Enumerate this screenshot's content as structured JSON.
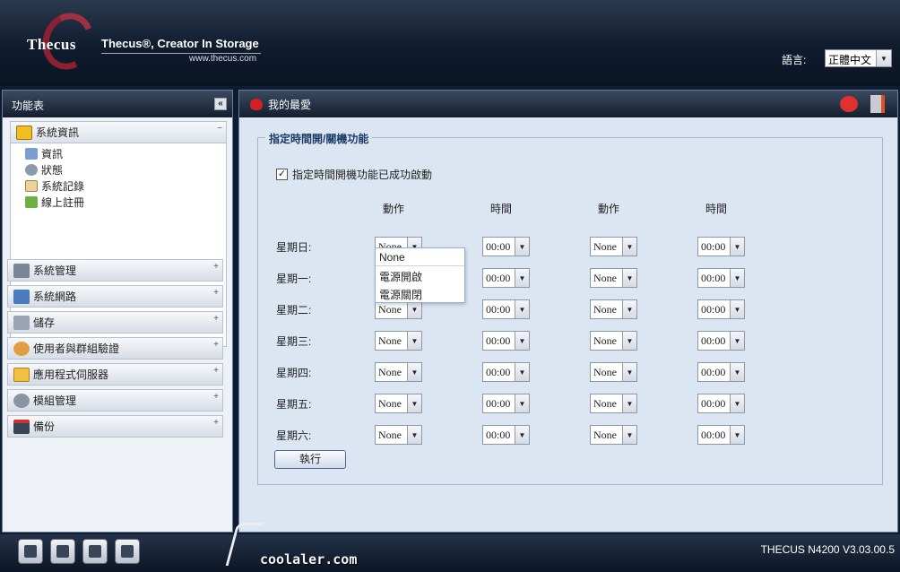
{
  "header": {
    "logo": "Thecus",
    "tagline": "Thecus®, Creator In Storage",
    "url": "www.thecus.com",
    "language_label": "語言:",
    "language_value": "正體中文"
  },
  "sidebar": {
    "title": "功能表",
    "collapse_label": "«",
    "open_section": {
      "label": "系統資訊",
      "toggle": "−",
      "items": [
        {
          "label": "資訊",
          "icon": "info-icon"
        },
        {
          "label": "狀態",
          "icon": "status-icon"
        },
        {
          "label": "系統記錄",
          "icon": "log-icon"
        },
        {
          "label": "線上註冊",
          "icon": "register-icon"
        }
      ]
    },
    "sections": [
      {
        "label": "系統管理",
        "icon": "tools-icon",
        "toggle": "+"
      },
      {
        "label": "系統網路",
        "icon": "network-icon",
        "toggle": "+"
      },
      {
        "label": "儲存",
        "icon": "storage-icon",
        "toggle": "+"
      },
      {
        "label": "使用者與群組驗證",
        "icon": "users-icon",
        "toggle": "+"
      },
      {
        "label": "應用程式伺服器",
        "icon": "app-server-icon",
        "toggle": "+"
      },
      {
        "label": "模組管理",
        "icon": "module-icon",
        "toggle": "+"
      },
      {
        "label": "備份",
        "icon": "backup-icon",
        "toggle": "+"
      }
    ]
  },
  "main": {
    "title": "我的最愛",
    "fieldset_title": "指定時間開/關機功能",
    "enable_checkbox_label": "指定時間開機功能已成功啟動",
    "enable_checked": true,
    "enable_check_glyph": "✓",
    "columns": [
      "動作",
      "時間",
      "動作",
      "時間"
    ],
    "schedule": [
      {
        "day": "星期日:",
        "action1": "None",
        "time1": "00:00",
        "action2": "None",
        "time2": "00:00"
      },
      {
        "day": "星期一:",
        "action1": "None",
        "time1": "00:00",
        "action2": "None",
        "time2": "00:00"
      },
      {
        "day": "星期二:",
        "action1": "None",
        "time1": "00:00",
        "action2": "None",
        "time2": "00:00"
      },
      {
        "day": "星期三:",
        "action1": "None",
        "time1": "00:00",
        "action2": "None",
        "time2": "00:00"
      },
      {
        "day": "星期四:",
        "action1": "None",
        "time1": "00:00",
        "action2": "None",
        "time2": "00:00"
      },
      {
        "day": "星期五:",
        "action1": "None",
        "time1": "00:00",
        "action2": "None",
        "time2": "00:00"
      },
      {
        "day": "星期六:",
        "action1": "None",
        "time1": "00:00",
        "action2": "None",
        "time2": "00:00"
      }
    ],
    "dropdown_options": [
      "None",
      "電源開啟",
      "電源關閉"
    ],
    "execute_label": "執行"
  },
  "footer": {
    "version": "THECUS N4200 V3.03.00.5",
    "watermark": "coolaler.com",
    "icons": [
      "server-icon",
      "disk-icon",
      "fan-icon",
      "network-tree-icon"
    ]
  },
  "colors": {
    "accent": "#1a3b66",
    "heart": "#d42025",
    "panel_bg": "#dce6f2"
  }
}
